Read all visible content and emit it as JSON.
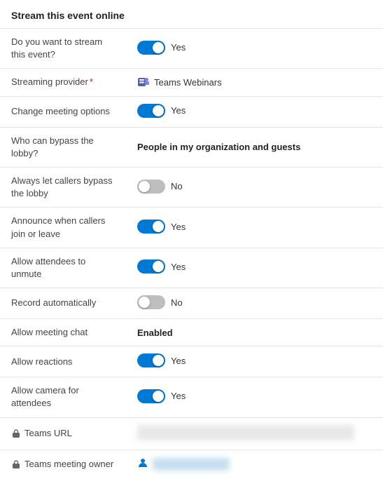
{
  "page": {
    "title": "Stream this event online"
  },
  "rows": [
    {
      "id": "stream-event",
      "label": "Do you want to stream this event?",
      "type": "toggle",
      "toggle_state": "on",
      "toggle_text": "Yes"
    },
    {
      "id": "streaming-provider",
      "label": "Streaming provider",
      "required": true,
      "type": "teams-webinars",
      "value": "Teams Webinars"
    },
    {
      "id": "change-meeting-options",
      "label": "Change meeting options",
      "type": "toggle",
      "toggle_state": "on",
      "toggle_text": "Yes"
    },
    {
      "id": "bypass-lobby",
      "label": "Who can bypass the lobby?",
      "type": "bold-text",
      "value": "People in my organization and guests"
    },
    {
      "id": "callers-bypass-lobby",
      "label": "Always let callers bypass the lobby",
      "type": "toggle",
      "toggle_state": "off",
      "toggle_text": "No"
    },
    {
      "id": "announce-callers",
      "label": "Announce when callers join or leave",
      "type": "toggle",
      "toggle_state": "on",
      "toggle_text": "Yes"
    },
    {
      "id": "allow-unmute",
      "label": "Allow attendees to unmute",
      "type": "toggle",
      "toggle_state": "on",
      "toggle_text": "Yes"
    },
    {
      "id": "record-automatically",
      "label": "Record automatically",
      "type": "toggle",
      "toggle_state": "off",
      "toggle_text": "No"
    },
    {
      "id": "meeting-chat",
      "label": "Allow meeting chat",
      "type": "bold-text",
      "value": "Enabled"
    },
    {
      "id": "allow-reactions",
      "label": "Allow reactions",
      "type": "toggle",
      "toggle_state": "on",
      "toggle_text": "Yes"
    },
    {
      "id": "allow-camera",
      "label": "Allow camera for attendees",
      "type": "toggle",
      "toggle_state": "on",
      "toggle_text": "Yes"
    },
    {
      "id": "teams-url",
      "label": "Teams URL",
      "type": "blurred-url",
      "has_lock": true
    },
    {
      "id": "teams-meeting-owner",
      "label": "Teams meeting owner",
      "type": "owner",
      "has_lock": true
    }
  ]
}
